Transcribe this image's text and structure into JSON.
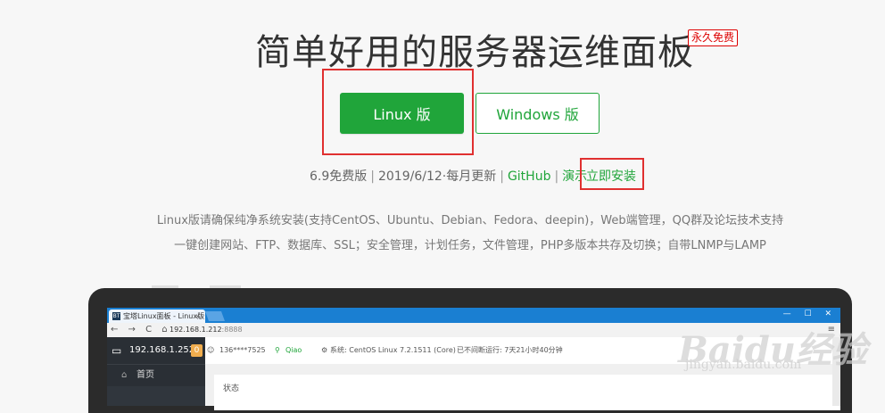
{
  "hero": {
    "title": "简单好用的服务器运维面板",
    "badge": "永久免费"
  },
  "buttons": {
    "linux": "Linux 版",
    "windows": "Windows 版"
  },
  "version_info": {
    "version": "6.9免费版",
    "date": "2019/6/12·每月更新",
    "github": "GitHub",
    "demo": "演示",
    "install": "立即安装"
  },
  "description": {
    "line1": "Linux版请确保纯净系统安装(支持CentOS、Ubuntu、Debian、Fedora、deepin)，Web端管理，QQ群及论坛技术支持",
    "line2": "一键创建网站、FTP、数据库、SSL；安全管理，计划任务，文件管理，PHP多版本共存及切换；自带LNMP与LAMP"
  },
  "preview": {
    "tab_icon": "BT",
    "tab_title": "宝塔Linux面板 - Linux版",
    "tab_close": "×",
    "window_controls": "— ☐ ✕",
    "nav_icons": "← → C ⌂",
    "url_main": "192.168.1.212",
    "url_port": ":8888",
    "menu_icon": "≡",
    "server_ip": "192.168.1.252",
    "server_badge": "0",
    "home_label": "首页",
    "user": "136****7525",
    "qq": "Qiao",
    "system": "系统:  CentOS Linux 7.2.1511 (Core)",
    "uptime": "已不间断运行: 7天21小时40分钟",
    "status_label": "状态"
  },
  "watermark": {
    "logo": "Baidu经验",
    "url": "jingyan.baidu.com"
  },
  "colors": {
    "brand_green": "#20a53a",
    "highlight_red": "#e03030",
    "browser_blue": "#1a7fd2"
  }
}
